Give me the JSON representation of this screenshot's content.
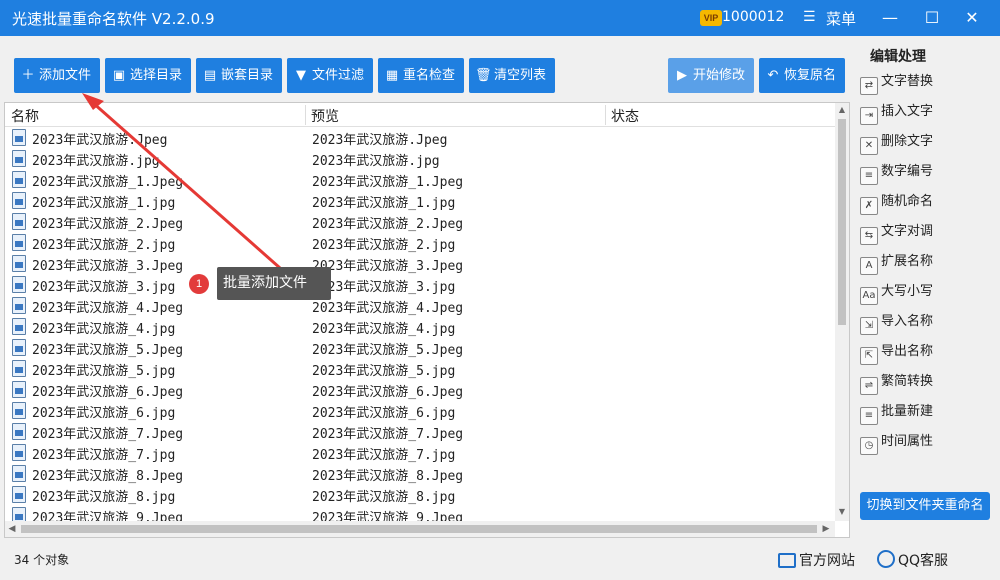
{
  "titlebar": {
    "title": "光速批量重命名软件 V2.2.0.9",
    "vip_badge": "VIP",
    "user_id": "1000012",
    "menu_icon": "hamburger-icon",
    "menu_label": "菜单",
    "minimize": "—",
    "maximize": "☐",
    "close": "✕",
    "color": "#1f7fe0"
  },
  "toolbar": {
    "add_file": "添加文件",
    "select_dir": "选择目录",
    "nested_dir": "嵌套目录",
    "file_filter": "文件过滤",
    "dup_check": "重名检查",
    "clear_list": "清空列表",
    "start": "开始修改",
    "restore": "恢复原名"
  },
  "side": {
    "title": "编辑处理",
    "items": [
      {
        "label": "文字替换",
        "icon": "replace-icon"
      },
      {
        "label": "插入文字",
        "icon": "insert-icon"
      },
      {
        "label": "删除文字",
        "icon": "delete-icon"
      },
      {
        "label": "数字编号",
        "icon": "numbering-icon"
      },
      {
        "label": "随机命名",
        "icon": "random-icon"
      },
      {
        "label": "文字对调",
        "icon": "swap-icon"
      },
      {
        "label": "扩展名称",
        "icon": "extension-icon"
      },
      {
        "label": "大写小写",
        "icon": "case-icon"
      },
      {
        "label": "导入名称",
        "icon": "import-icon"
      },
      {
        "label": "导出名称",
        "icon": "export-icon"
      },
      {
        "label": "繁简转换",
        "icon": "convert-icon"
      },
      {
        "label": "批量新建",
        "icon": "new-icon"
      },
      {
        "label": "时间属性",
        "icon": "clock-icon"
      }
    ],
    "switch_button": "切换到文件夹重命名"
  },
  "list": {
    "columns": [
      "名称",
      "预览",
      "状态"
    ],
    "rows": [
      {
        "name": "2023年武汉旅游.Jpeg",
        "preview": "2023年武汉旅游.Jpeg"
      },
      {
        "name": "2023年武汉旅游.jpg",
        "preview": "2023年武汉旅游.jpg"
      },
      {
        "name": "2023年武汉旅游_1.Jpeg",
        "preview": "2023年武汉旅游_1.Jpeg"
      },
      {
        "name": "2023年武汉旅游_1.jpg",
        "preview": "2023年武汉旅游_1.jpg"
      },
      {
        "name": "2023年武汉旅游_2.Jpeg",
        "preview": "2023年武汉旅游_2.Jpeg"
      },
      {
        "name": "2023年武汉旅游_2.jpg",
        "preview": "2023年武汉旅游_2.jpg"
      },
      {
        "name": "2023年武汉旅游_3.Jpeg",
        "preview": "2023年武汉旅游_3.Jpeg"
      },
      {
        "name": "2023年武汉旅游_3.jpg",
        "preview": "2023年武汉旅游_3.jpg"
      },
      {
        "name": "2023年武汉旅游_4.Jpeg",
        "preview": "2023年武汉旅游_4.Jpeg"
      },
      {
        "name": "2023年武汉旅游_4.jpg",
        "preview": "2023年武汉旅游_4.jpg"
      },
      {
        "name": "2023年武汉旅游_5.Jpeg",
        "preview": "2023年武汉旅游_5.Jpeg"
      },
      {
        "name": "2023年武汉旅游_5.jpg",
        "preview": "2023年武汉旅游_5.jpg"
      },
      {
        "name": "2023年武汉旅游_6.Jpeg",
        "preview": "2023年武汉旅游_6.Jpeg"
      },
      {
        "name": "2023年武汉旅游_6.jpg",
        "preview": "2023年武汉旅游_6.jpg"
      },
      {
        "name": "2023年武汉旅游_7.Jpeg",
        "preview": "2023年武汉旅游_7.Jpeg"
      },
      {
        "name": "2023年武汉旅游_7.jpg",
        "preview": "2023年武汉旅游_7.jpg"
      },
      {
        "name": "2023年武汉旅游_8.Jpeg",
        "preview": "2023年武汉旅游_8.Jpeg"
      },
      {
        "name": "2023年武汉旅游_8.jpg",
        "preview": "2023年武汉旅游_8.jpg"
      },
      {
        "name": "2023年武汉旅游_9.Jpeg",
        "preview": "2023年武汉旅游_9.Jpeg"
      }
    ]
  },
  "tooltip": {
    "badge": "1",
    "text": "批量添加文件",
    "arrow_color": "#e53935"
  },
  "status": {
    "count": "34 个对象",
    "website": "官方网站",
    "qq": "QQ客服"
  }
}
